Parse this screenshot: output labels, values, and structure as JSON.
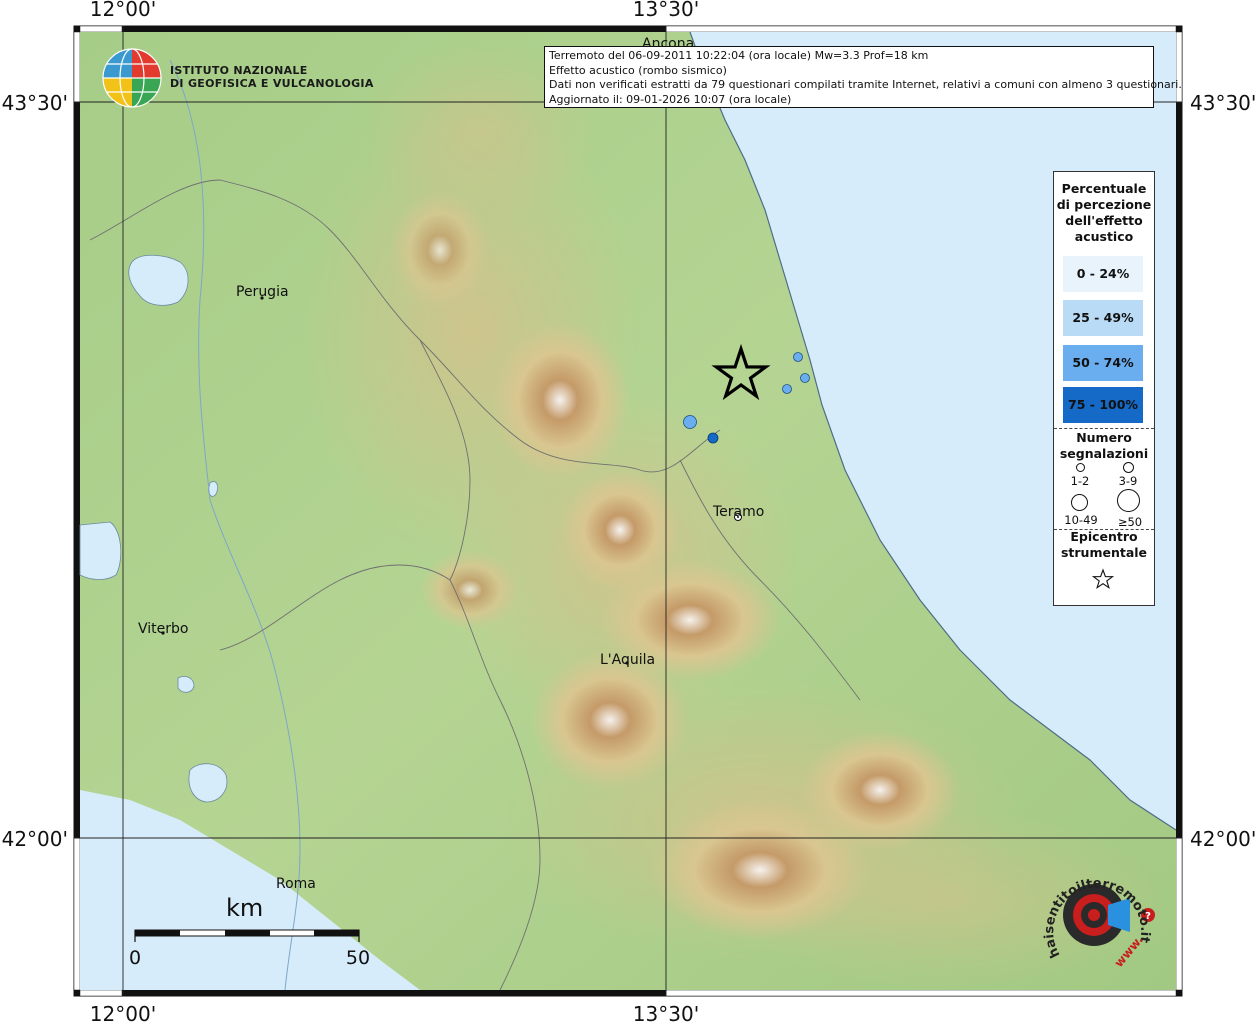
{
  "logo": {
    "line1": "ISTITUTO NAZIONALE",
    "line2": "DI GEOFISICA E VULCANOLOGIA"
  },
  "header": {
    "line1": "Terremoto del 06-09-2011 10:22:04 (ora locale) Mw=3.3 Prof=18 km",
    "line2": "Effetto acustico (rombo sismico)",
    "line3": "Dati non verificati estratti da 79 questionari compilati tramite Internet, relativi a comuni con almeno 3 questionari.",
    "line4": "Aggiornato il: 09-01-2026 10:07 (ora locale)"
  },
  "axes": {
    "top_left": "12°00'",
    "top_right": "13°30'",
    "bottom_left": "12°00'",
    "bottom_right": "13°30'",
    "left_top": "43°30'",
    "left_bottom": "42°00'",
    "right_top": "43°30'",
    "right_bottom": "42°00'"
  },
  "cities": {
    "ancona": "Ancona",
    "perugia": "Perugia",
    "teramo": "Teramo",
    "viterbo": "Viterbo",
    "laquila": "L'Aquila",
    "roma": "Roma"
  },
  "scale": {
    "unit": "km",
    "min": "0",
    "max": "50"
  },
  "legend": {
    "title": [
      "Percentuale",
      "di percezione",
      "dell'effetto",
      "acustico"
    ],
    "classes": [
      {
        "label": "0 - 24%",
        "color": "#e8f3fc"
      },
      {
        "label": "25 - 49%",
        "color": "#b9dbf6"
      },
      {
        "label": "50 - 74%",
        "color": "#6aaef0"
      },
      {
        "label": "75 - 100%",
        "color": "#1569c7"
      }
    ],
    "count_title": [
      "Numero",
      "segnalazioni"
    ],
    "counts": [
      "1-2",
      "3-9",
      "10-49",
      "≥50"
    ],
    "epicenter_title": [
      "Epicentro",
      "strumentale"
    ]
  },
  "observations": [
    {
      "class": "50 - 74%",
      "count": "3-9"
    },
    {
      "class": "25 - 49%",
      "count": "1-2"
    },
    {
      "class": "25 - 49%",
      "count": "1-2"
    },
    {
      "class": "25 - 49%",
      "count": "1-2"
    },
    {
      "class": "75 - 100%",
      "count": "1-2"
    }
  ],
  "brand": {
    "text": "haisentitoilterremoto.it",
    "prefix": "www."
  },
  "colors": {
    "sea": "#d6ecfa",
    "lowland": "#a9cf86",
    "hills": "#d7c48e",
    "mountains": "#b98a52",
    "peaks": "#f4f1ee"
  }
}
